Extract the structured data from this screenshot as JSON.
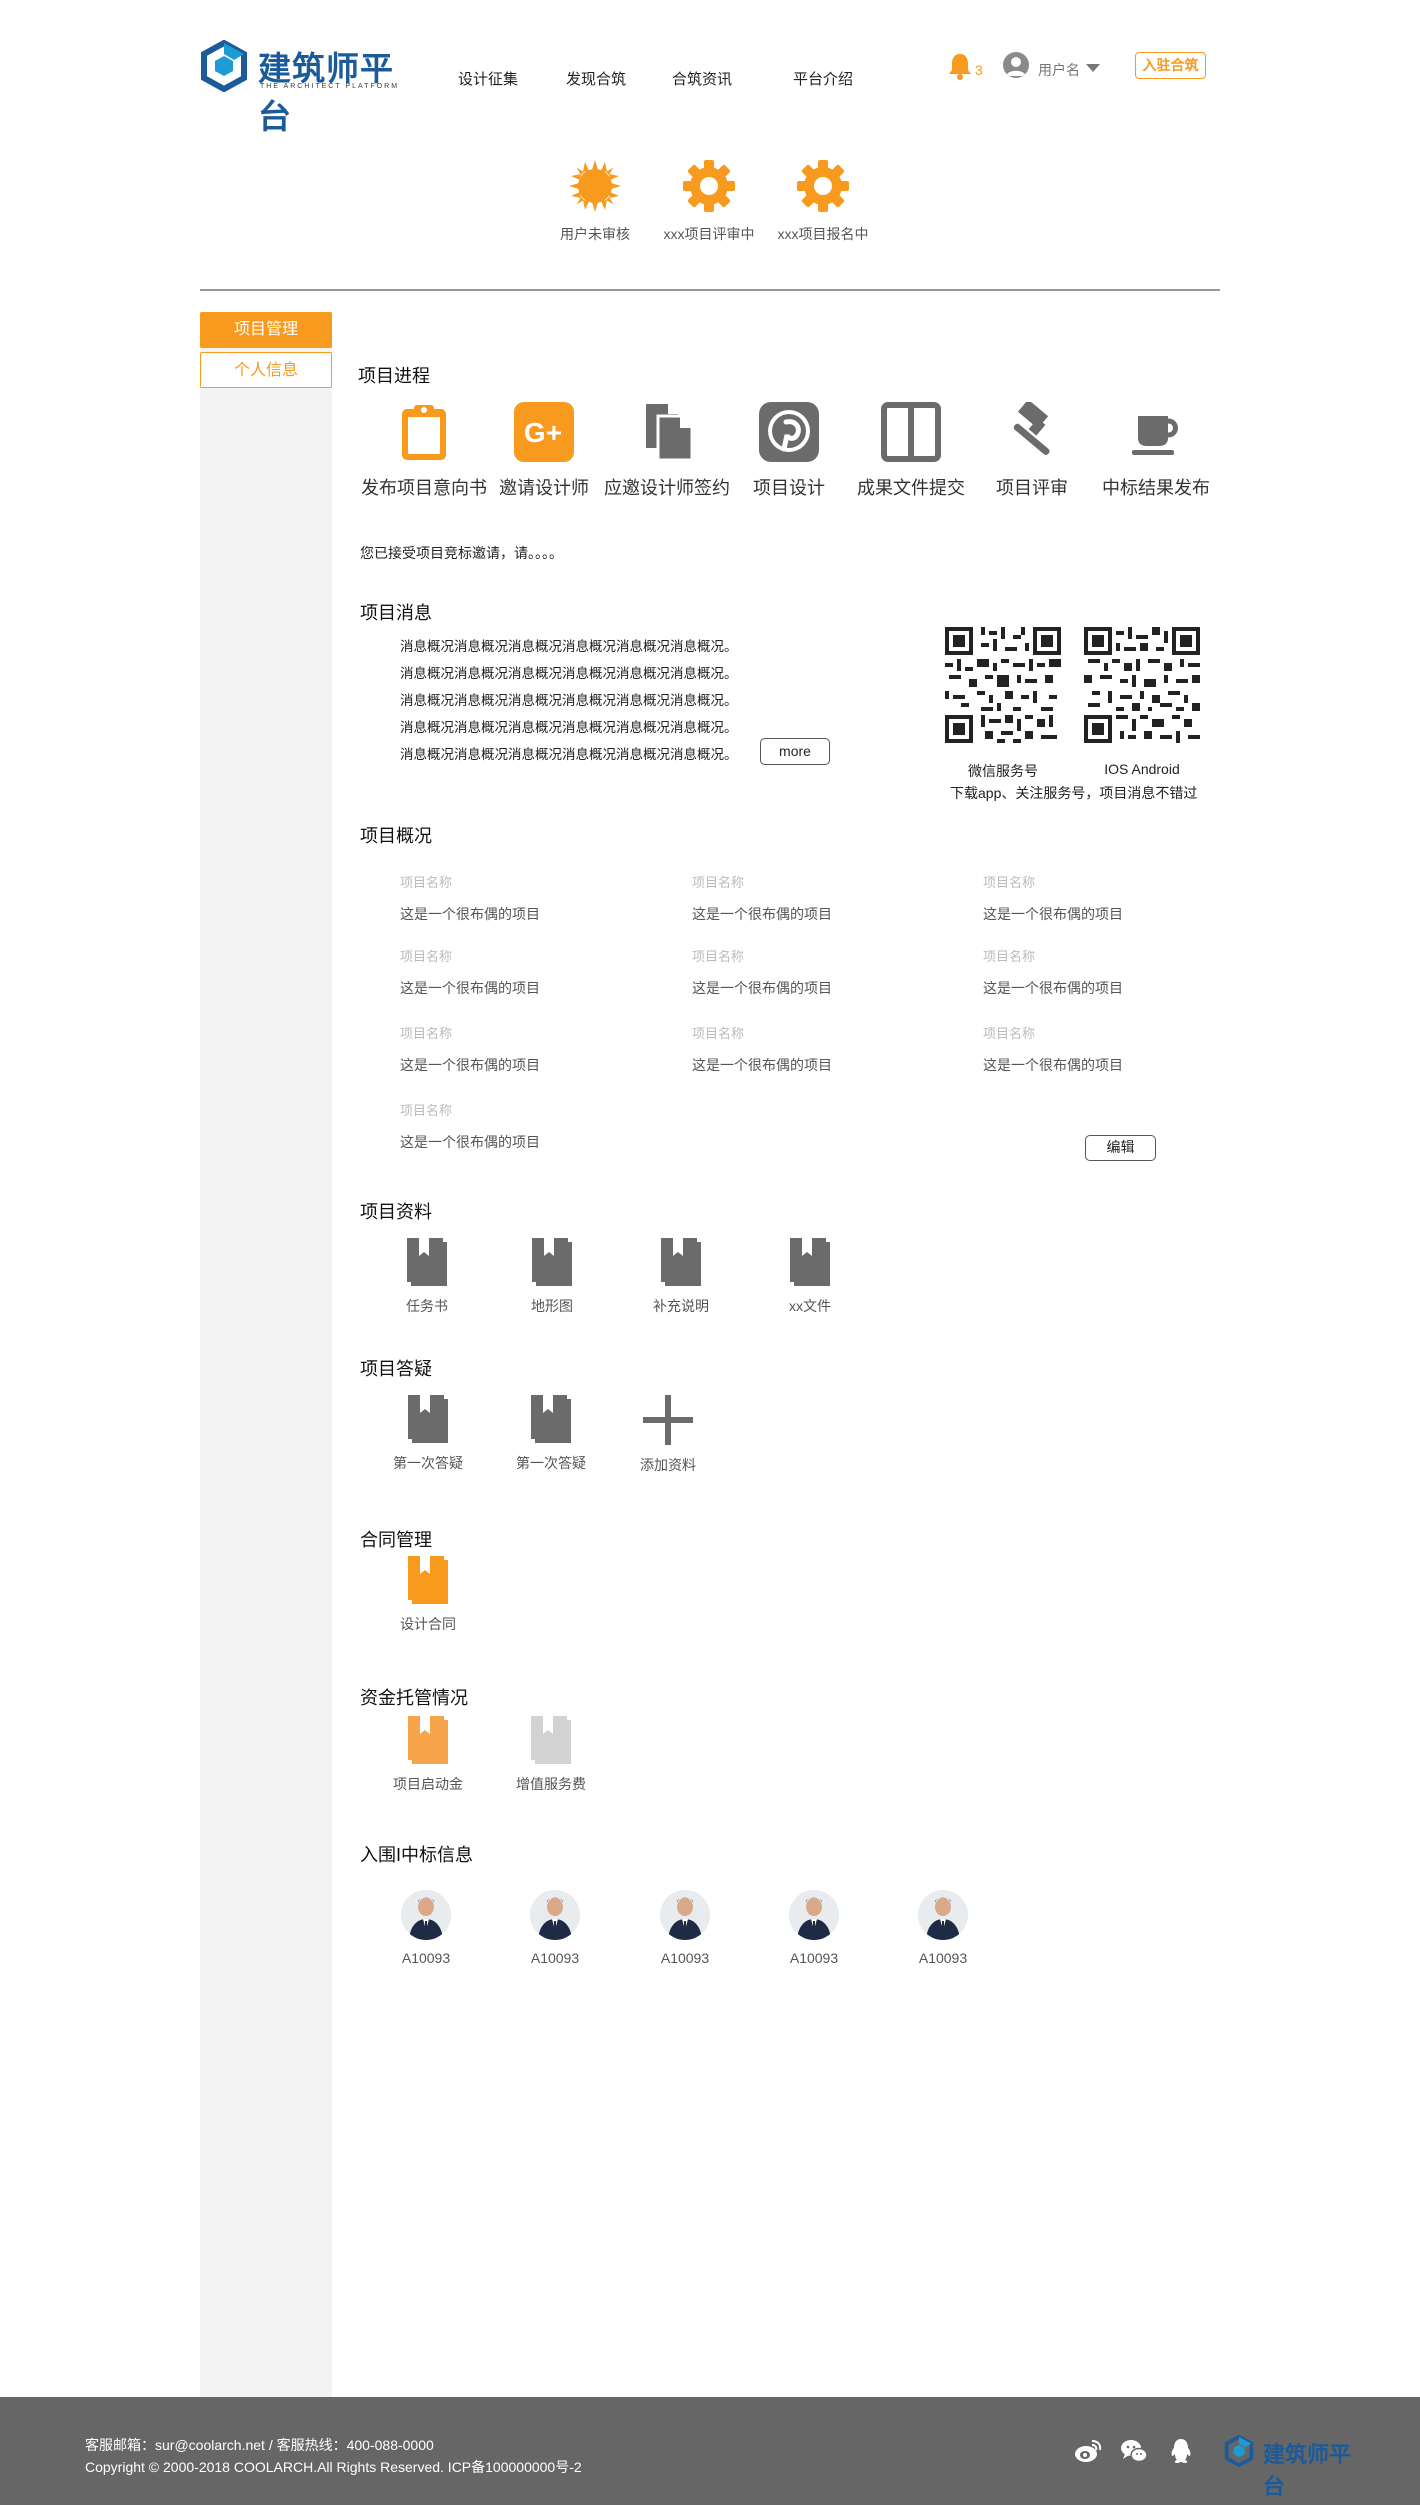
{
  "header": {
    "logo_text": "建筑师平台",
    "logo_sub": "THE ARCHITECT PLATFORM",
    "nav": [
      "设计征集",
      "发现合筑",
      "合筑资讯",
      "平台介绍"
    ],
    "notification_count": "3",
    "username": "用户名",
    "join_label": "入驻合筑"
  },
  "status": [
    {
      "label": "用户未审核",
      "icon": "sun-icon"
    },
    {
      "label": "xxx项目评审中",
      "icon": "gear-icon"
    },
    {
      "label": "xxx项目报名中",
      "icon": "gear-icon"
    }
  ],
  "sidebar": {
    "items": [
      {
        "label": "项目管理",
        "active": true
      },
      {
        "label": "个人信息",
        "active": false
      }
    ]
  },
  "progress": {
    "title": "项目进程",
    "steps": [
      {
        "label": "发布项目意向书",
        "icon": "clipboard-icon"
      },
      {
        "label": "邀请设计师",
        "icon": "google-plus-icon"
      },
      {
        "label": "应邀设计师签约",
        "icon": "copy-file-icon"
      },
      {
        "label": "项目设计",
        "icon": "pinterest-icon"
      },
      {
        "label": "成果文件提交",
        "icon": "columns-icon"
      },
      {
        "label": "项目评审",
        "icon": "gavel-icon"
      },
      {
        "label": "中标结果发布",
        "icon": "coffee-cup-icon"
      }
    ],
    "notice": "您已接受项目竞标邀请，请。。。。"
  },
  "messages": {
    "title": "项目消息",
    "lines": [
      "消息概况消息概况消息概况消息概况消息概况消息概况。",
      "消息概况消息概况消息概况消息概况消息概况消息概况。",
      "消息概况消息概况消息概况消息概况消息概况消息概况。",
      "消息概况消息概况消息概况消息概况消息概况消息概况。",
      "消息概况消息概况消息概况消息概况消息概况消息概况。"
    ],
    "more_label": "more",
    "qr_labels": [
      "微信服务号",
      "IOS Android"
    ],
    "qr_desc": "下载app、关注服务号，项目消息不错过"
  },
  "overview": {
    "title": "项目概况",
    "items": [
      {
        "key": "项目名称",
        "value": "这是一个很布偶的项目"
      },
      {
        "key": "项目名称",
        "value": "这是一个很布偶的项目"
      },
      {
        "key": "项目名称",
        "value": "这是一个很布偶的项目"
      },
      {
        "key": "项目名称",
        "value": "这是一个很布偶的项目"
      },
      {
        "key": "项目名称",
        "value": "这是一个很布偶的项目"
      },
      {
        "key": "项目名称",
        "value": "这是一个很布偶的项目"
      },
      {
        "key": "项目名称",
        "value": "这是一个很布偶的项目"
      },
      {
        "key": "项目名称",
        "value": "这是一个很布偶的项目"
      },
      {
        "key": "项目名称",
        "value": "这是一个很布偶的项目"
      },
      {
        "key": "项目名称",
        "value": "这是一个很布偶的项目"
      }
    ],
    "edit_label": "编辑"
  },
  "materials": {
    "title": "项目资料",
    "items": [
      "任务书",
      "地形图",
      "补充说明",
      "xx文件"
    ]
  },
  "qa": {
    "title": "项目答疑",
    "items": [
      "第一次答疑",
      "第一次答疑"
    ],
    "add_label": "添加资料"
  },
  "contract": {
    "title": "合同管理",
    "items": [
      "设计合同"
    ]
  },
  "escrow": {
    "title": "资金托管情况",
    "items": [
      "项目启动金",
      "增值服务费"
    ]
  },
  "shortlist": {
    "title": "入围I中标信息",
    "people": [
      "A10093",
      "A10093",
      "A10093",
      "A10093",
      "A10093"
    ]
  },
  "footer": {
    "line1": "客服邮箱：sur@coolarch.net / 客服热线：400-088-0000",
    "line2": "Copyright © 2000-2018 COOLARCH.All Rights Reserved.  ICP备100000000号-2",
    "logo_text": "建筑师平台"
  },
  "colors": {
    "accent": "#f79a1d",
    "icon_gray": "#6b6b6b",
    "brand_blue": "#1c5b9a",
    "footer_bg": "#666666"
  }
}
